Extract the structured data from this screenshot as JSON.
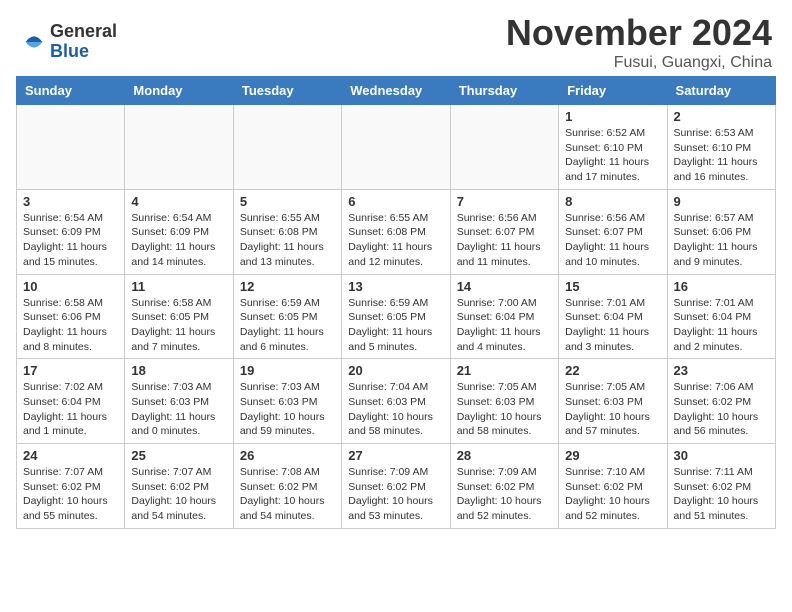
{
  "header": {
    "logo_line1": "General",
    "logo_line2": "Blue",
    "title": "November 2024",
    "subtitle": "Fusui, Guangxi, China"
  },
  "calendar": {
    "headers": [
      "Sunday",
      "Monday",
      "Tuesday",
      "Wednesday",
      "Thursday",
      "Friday",
      "Saturday"
    ],
    "weeks": [
      [
        {
          "num": "",
          "info": "",
          "empty": true
        },
        {
          "num": "",
          "info": "",
          "empty": true
        },
        {
          "num": "",
          "info": "",
          "empty": true
        },
        {
          "num": "",
          "info": "",
          "empty": true
        },
        {
          "num": "",
          "info": "",
          "empty": true
        },
        {
          "num": "1",
          "info": "Sunrise: 6:52 AM\nSunset: 6:10 PM\nDaylight: 11 hours\nand 17 minutes."
        },
        {
          "num": "2",
          "info": "Sunrise: 6:53 AM\nSunset: 6:10 PM\nDaylight: 11 hours\nand 16 minutes."
        }
      ],
      [
        {
          "num": "3",
          "info": "Sunrise: 6:54 AM\nSunset: 6:09 PM\nDaylight: 11 hours\nand 15 minutes."
        },
        {
          "num": "4",
          "info": "Sunrise: 6:54 AM\nSunset: 6:09 PM\nDaylight: 11 hours\nand 14 minutes."
        },
        {
          "num": "5",
          "info": "Sunrise: 6:55 AM\nSunset: 6:08 PM\nDaylight: 11 hours\nand 13 minutes."
        },
        {
          "num": "6",
          "info": "Sunrise: 6:55 AM\nSunset: 6:08 PM\nDaylight: 11 hours\nand 12 minutes."
        },
        {
          "num": "7",
          "info": "Sunrise: 6:56 AM\nSunset: 6:07 PM\nDaylight: 11 hours\nand 11 minutes."
        },
        {
          "num": "8",
          "info": "Sunrise: 6:56 AM\nSunset: 6:07 PM\nDaylight: 11 hours\nand 10 minutes."
        },
        {
          "num": "9",
          "info": "Sunrise: 6:57 AM\nSunset: 6:06 PM\nDaylight: 11 hours\nand 9 minutes."
        }
      ],
      [
        {
          "num": "10",
          "info": "Sunrise: 6:58 AM\nSunset: 6:06 PM\nDaylight: 11 hours\nand 8 minutes."
        },
        {
          "num": "11",
          "info": "Sunrise: 6:58 AM\nSunset: 6:05 PM\nDaylight: 11 hours\nand 7 minutes."
        },
        {
          "num": "12",
          "info": "Sunrise: 6:59 AM\nSunset: 6:05 PM\nDaylight: 11 hours\nand 6 minutes."
        },
        {
          "num": "13",
          "info": "Sunrise: 6:59 AM\nSunset: 6:05 PM\nDaylight: 11 hours\nand 5 minutes."
        },
        {
          "num": "14",
          "info": "Sunrise: 7:00 AM\nSunset: 6:04 PM\nDaylight: 11 hours\nand 4 minutes."
        },
        {
          "num": "15",
          "info": "Sunrise: 7:01 AM\nSunset: 6:04 PM\nDaylight: 11 hours\nand 3 minutes."
        },
        {
          "num": "16",
          "info": "Sunrise: 7:01 AM\nSunset: 6:04 PM\nDaylight: 11 hours\nand 2 minutes."
        }
      ],
      [
        {
          "num": "17",
          "info": "Sunrise: 7:02 AM\nSunset: 6:04 PM\nDaylight: 11 hours\nand 1 minute."
        },
        {
          "num": "18",
          "info": "Sunrise: 7:03 AM\nSunset: 6:03 PM\nDaylight: 11 hours\nand 0 minutes."
        },
        {
          "num": "19",
          "info": "Sunrise: 7:03 AM\nSunset: 6:03 PM\nDaylight: 10 hours\nand 59 minutes."
        },
        {
          "num": "20",
          "info": "Sunrise: 7:04 AM\nSunset: 6:03 PM\nDaylight: 10 hours\nand 58 minutes."
        },
        {
          "num": "21",
          "info": "Sunrise: 7:05 AM\nSunset: 6:03 PM\nDaylight: 10 hours\nand 58 minutes."
        },
        {
          "num": "22",
          "info": "Sunrise: 7:05 AM\nSunset: 6:03 PM\nDaylight: 10 hours\nand 57 minutes."
        },
        {
          "num": "23",
          "info": "Sunrise: 7:06 AM\nSunset: 6:02 PM\nDaylight: 10 hours\nand 56 minutes."
        }
      ],
      [
        {
          "num": "24",
          "info": "Sunrise: 7:07 AM\nSunset: 6:02 PM\nDaylight: 10 hours\nand 55 minutes."
        },
        {
          "num": "25",
          "info": "Sunrise: 7:07 AM\nSunset: 6:02 PM\nDaylight: 10 hours\nand 54 minutes."
        },
        {
          "num": "26",
          "info": "Sunrise: 7:08 AM\nSunset: 6:02 PM\nDaylight: 10 hours\nand 54 minutes."
        },
        {
          "num": "27",
          "info": "Sunrise: 7:09 AM\nSunset: 6:02 PM\nDaylight: 10 hours\nand 53 minutes."
        },
        {
          "num": "28",
          "info": "Sunrise: 7:09 AM\nSunset: 6:02 PM\nDaylight: 10 hours\nand 52 minutes."
        },
        {
          "num": "29",
          "info": "Sunrise: 7:10 AM\nSunset: 6:02 PM\nDaylight: 10 hours\nand 52 minutes."
        },
        {
          "num": "30",
          "info": "Sunrise: 7:11 AM\nSunset: 6:02 PM\nDaylight: 10 hours\nand 51 minutes."
        }
      ]
    ]
  }
}
